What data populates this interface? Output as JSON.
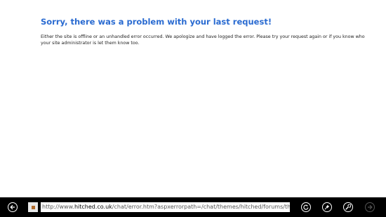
{
  "error": {
    "title": "Sorry, there was a problem with your last request!",
    "message": "Either the site is offline or an unhandled error occurred. We apologize and have logged the error. Please try your request again or if you know who your site administrator is let them know too."
  },
  "addressbar": {
    "url_prefix": "http://www.",
    "url_domain": "hitched.co.uk",
    "url_path": "/chat/error.htm?aspxerrorpath=/chat/themes/hitched/forums/threadl"
  },
  "icons": {
    "back": "back-arrow-icon",
    "favicon": "site-favicon",
    "refresh": "refresh-icon",
    "pin": "pin-icon",
    "tools": "wrench-icon",
    "forward": "forward-arrow-icon"
  },
  "colors": {
    "title": "#2a6bd1",
    "appbar": "#000000",
    "text": "#222222"
  }
}
